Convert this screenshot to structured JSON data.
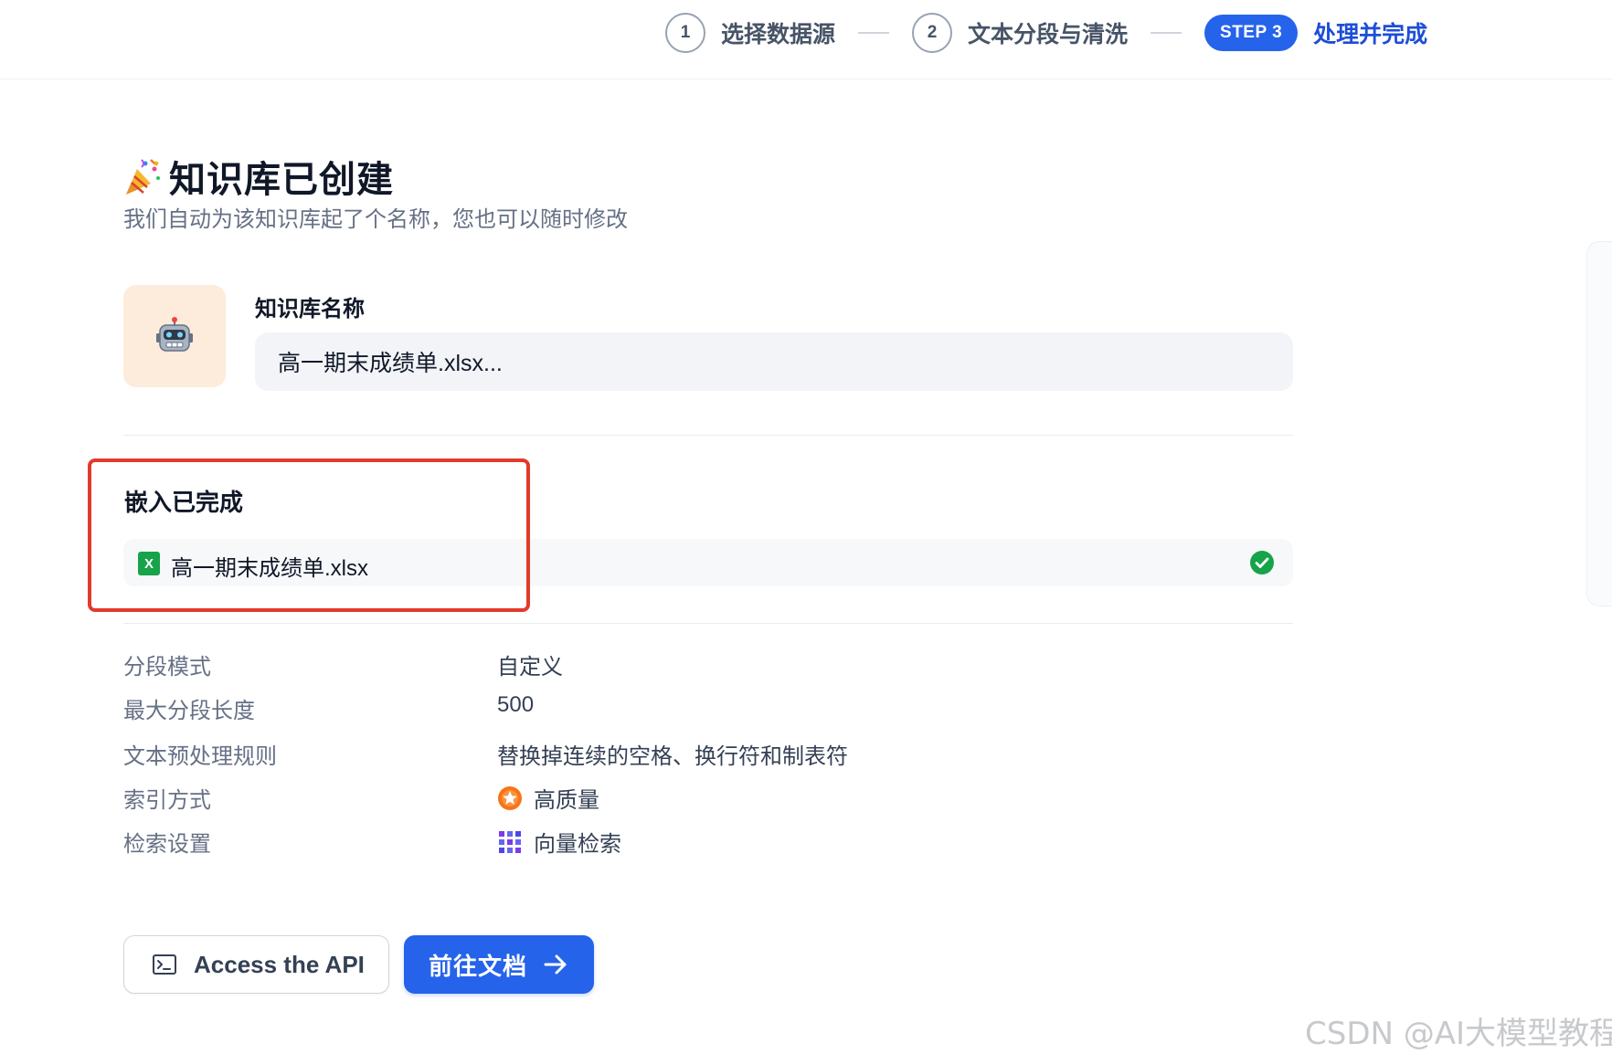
{
  "stepper": {
    "step1_num": "1",
    "step1_label": "选择数据源",
    "step2_num": "2",
    "step2_label": "文本分段与清洗",
    "step3_pill": "STEP 3",
    "step3_label": "处理并完成",
    "active_color": "#2563eb"
  },
  "header": {
    "title": "知识库已创建",
    "subtitle": "我们自动为该知识库起了个名称，您也可以随时修改",
    "icon": "party-popper-icon"
  },
  "knowledge": {
    "avatar_icon": "robot-icon",
    "name_label": "知识库名称",
    "name_value": "高一期末成绩单.xlsx..."
  },
  "embedding": {
    "title": "嵌入已完成",
    "file_name": "高一期末成绩单.xlsx",
    "file_icon": "excel-file-icon",
    "status_icon": "check-circle-icon",
    "highlight_color": "#e23a2b"
  },
  "settings": [
    {
      "key": "分段模式",
      "value": "自定义"
    },
    {
      "key": "最大分段长度",
      "value": "500"
    },
    {
      "key": "文本预处理规则",
      "value": "替换掉连续的空格、换行符和制表符"
    },
    {
      "key": "索引方式",
      "value": "高质量",
      "icon": "high-quality-icon"
    },
    {
      "key": "检索设置",
      "value": "向量检索",
      "icon": "vector-search-icon"
    }
  ],
  "actions": {
    "api_label": "Access the API",
    "api_icon": "terminal-icon",
    "go_label": "前往文档",
    "go_icon": "arrow-right-icon"
  },
  "watermark": "CSDN @AI大模型教程"
}
